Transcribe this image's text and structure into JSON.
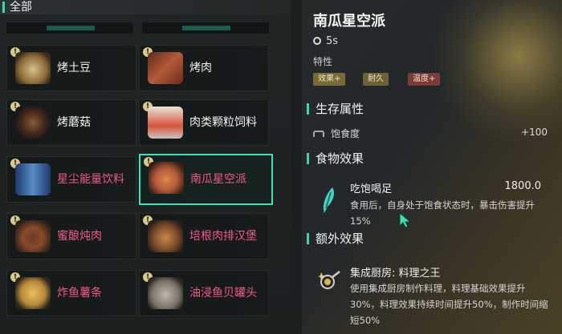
{
  "category": {
    "label": "全部"
  },
  "items": [
    {
      "name": "烤土豆",
      "color": "white",
      "thumb": "potato"
    },
    {
      "name": "烤肉",
      "color": "white",
      "thumb": "meat"
    },
    {
      "name": "烤蘑菇",
      "color": "white",
      "thumb": "skewer"
    },
    {
      "name": "肉类颗粒饲料",
      "color": "white",
      "thumb": "bag"
    },
    {
      "name": "星尘能量饮料",
      "color": "pink",
      "thumb": "can"
    },
    {
      "name": "南瓜星空派",
      "color": "pink",
      "thumb": "pie",
      "selected": true
    },
    {
      "name": "蜜酿炖肉",
      "color": "pink",
      "thumb": "stew"
    },
    {
      "name": "培根肉排汉堡",
      "color": "pink",
      "thumb": "burger"
    },
    {
      "name": "炸鱼薯条",
      "color": "pink",
      "thumb": "fries"
    },
    {
      "name": "油浸鱼贝罐头",
      "color": "pink",
      "thumb": "tin"
    }
  ],
  "detail": {
    "title": "南瓜星空派",
    "time": "5s",
    "traits_label": "特性",
    "tags": [
      {
        "label": "效果+",
        "color": "#7a6a3a"
      },
      {
        "label": "耐久",
        "color": "#6e6136"
      },
      {
        "label": "温度+",
        "color": "#7a3a3a"
      }
    ],
    "survival": {
      "title": "生存属性",
      "stat_label": "饱食度",
      "stat_value": "+100"
    },
    "food_effect": {
      "title": "食物效果",
      "name": "吃饱喝足",
      "value": "1800.0",
      "desc": "食用后，自身处于饱食状态时，暴击伤害提升15%"
    },
    "extra_effect": {
      "title": "额外效果",
      "name": "集成厨房: 料理之王",
      "desc": "使用集成厨房制作料理，料理基础效果提升30%，料理效果持续时间提升50%，制作时间缩短50%"
    }
  }
}
